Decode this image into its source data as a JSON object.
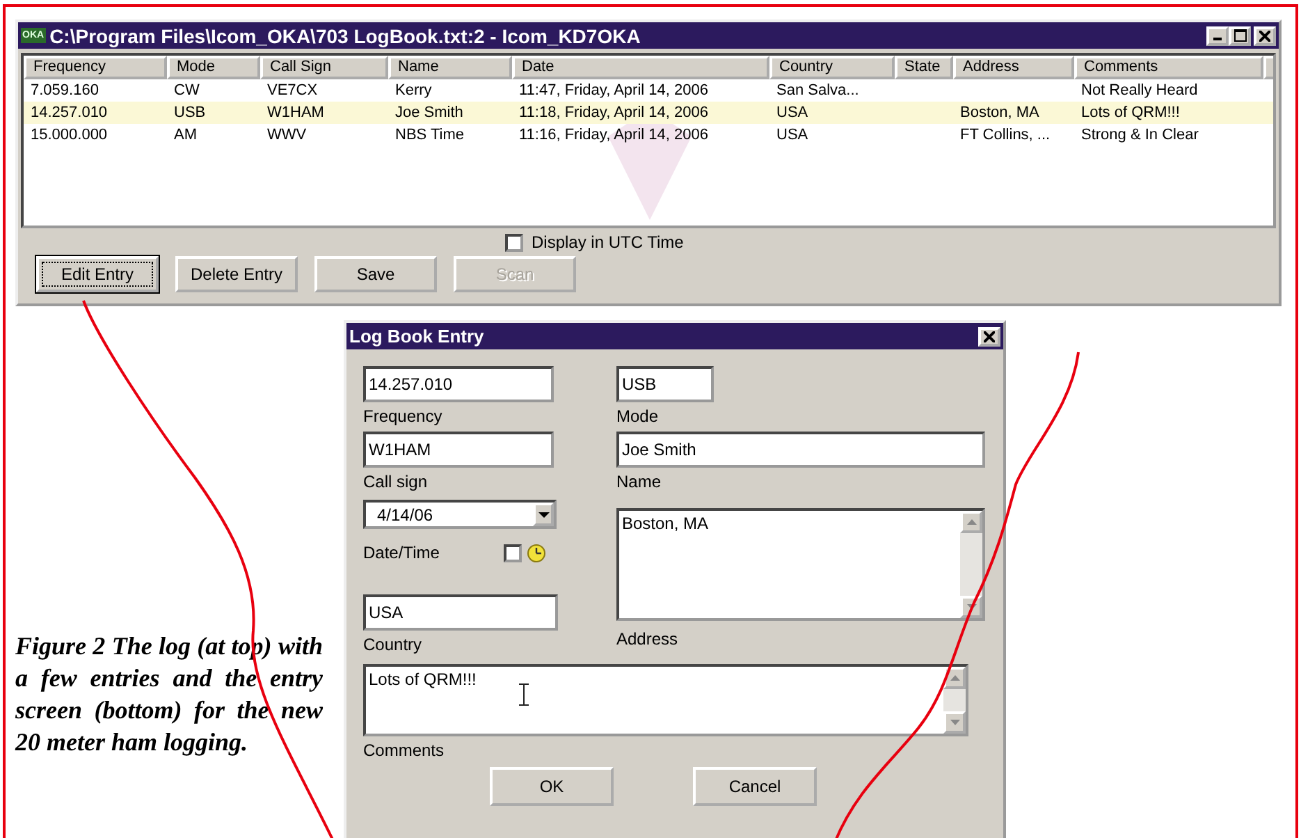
{
  "log_window": {
    "app_badge": "OKA",
    "title": "C:\\Program Files\\Icom_OKA\\703 LogBook.txt:2 - Icom_KD7OKA",
    "table": {
      "columns": [
        "Frequency",
        "Mode",
        "Call Sign",
        "Name",
        "Date",
        "Country",
        "State",
        "Address",
        "Comments"
      ],
      "rows": [
        {
          "cells": [
            "7.059.160",
            "CW",
            "VE7CX",
            "Kerry",
            "11:47, Friday, April 14, 2006",
            "San Salva...",
            "",
            "",
            "Not Really Heard"
          ],
          "selected": false
        },
        {
          "cells": [
            "14.257.010",
            "USB",
            "W1HAM",
            "Joe Smith",
            "11:18, Friday, April 14, 2006",
            "USA",
            "",
            "Boston, MA",
            "Lots of QRM!!!"
          ],
          "selected": true
        },
        {
          "cells": [
            "15.000.000",
            "AM",
            "WWV",
            "NBS Time",
            "11:16, Friday, April 14, 2006",
            "USA",
            "",
            "FT Collins, ...",
            "Strong & In Clear"
          ],
          "selected": false
        }
      ]
    },
    "utc_option": {
      "label": "Display in UTC Time",
      "checked": false
    },
    "buttons": [
      {
        "label": "Edit Entry",
        "focused": true,
        "disabled": false
      },
      {
        "label": "Delete Entry",
        "focused": false,
        "disabled": false
      },
      {
        "label": "Save",
        "focused": false,
        "disabled": false
      },
      {
        "label": "Scan",
        "focused": false,
        "disabled": true
      }
    ]
  },
  "entry_dialog": {
    "title": "Log Book Entry",
    "frequency": {
      "value": "14.257.010",
      "label": "Frequency"
    },
    "mode": {
      "value": "USB",
      "label": "Mode"
    },
    "call_sign": {
      "value": "W1HAM",
      "label": "Call sign"
    },
    "name": {
      "value": "Joe Smith",
      "label": "Name"
    },
    "date": {
      "value": "4/14/06",
      "label": "Date/Time",
      "time_checked": false
    },
    "country": {
      "value": "USA",
      "label": "Country"
    },
    "address": {
      "value": "Boston, MA",
      "label": "Address"
    },
    "comments": {
      "value": "Lots of QRM!!!",
      "label": "Comments"
    },
    "buttons": [
      "OK",
      "Cancel"
    ]
  },
  "caption": "Figure 2 The log (at top) with a few entries and the entry screen (bottom) for the new 20 meter ham logging."
}
